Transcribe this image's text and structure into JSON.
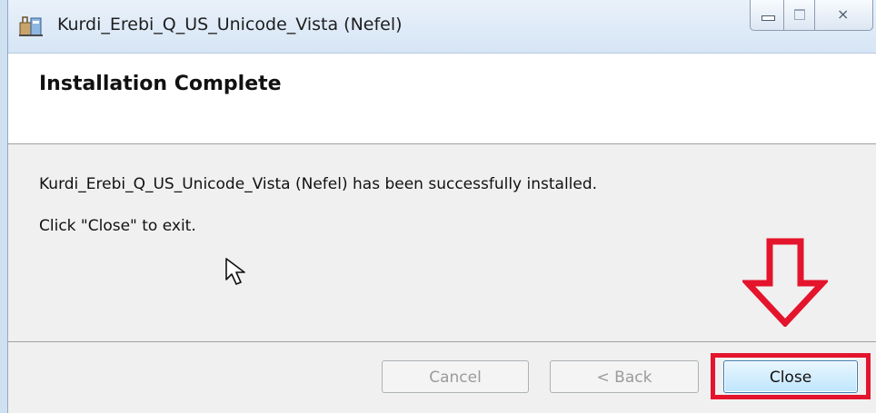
{
  "window": {
    "title": "Kurdi_Erebi_Q_US_Unicode_Vista (Nefel)",
    "icon": "installer-package-icon",
    "caption_buttons": {
      "minimize": "minimize-icon",
      "maximize": "maximize-icon",
      "close": "close-icon",
      "close_glyph": "⨯"
    }
  },
  "header": {
    "title": "Installation Complete"
  },
  "body": {
    "message": "Kurdi_Erebi_Q_US_Unicode_Vista (Nefel) has been successfully installed.",
    "instruction": "Click \"Close\" to exit."
  },
  "footer": {
    "cancel_label": "Cancel",
    "back_label": "< Back",
    "close_label": "Close"
  },
  "annotation": {
    "color": "#e4142c",
    "arrow": "down-arrow-icon"
  }
}
